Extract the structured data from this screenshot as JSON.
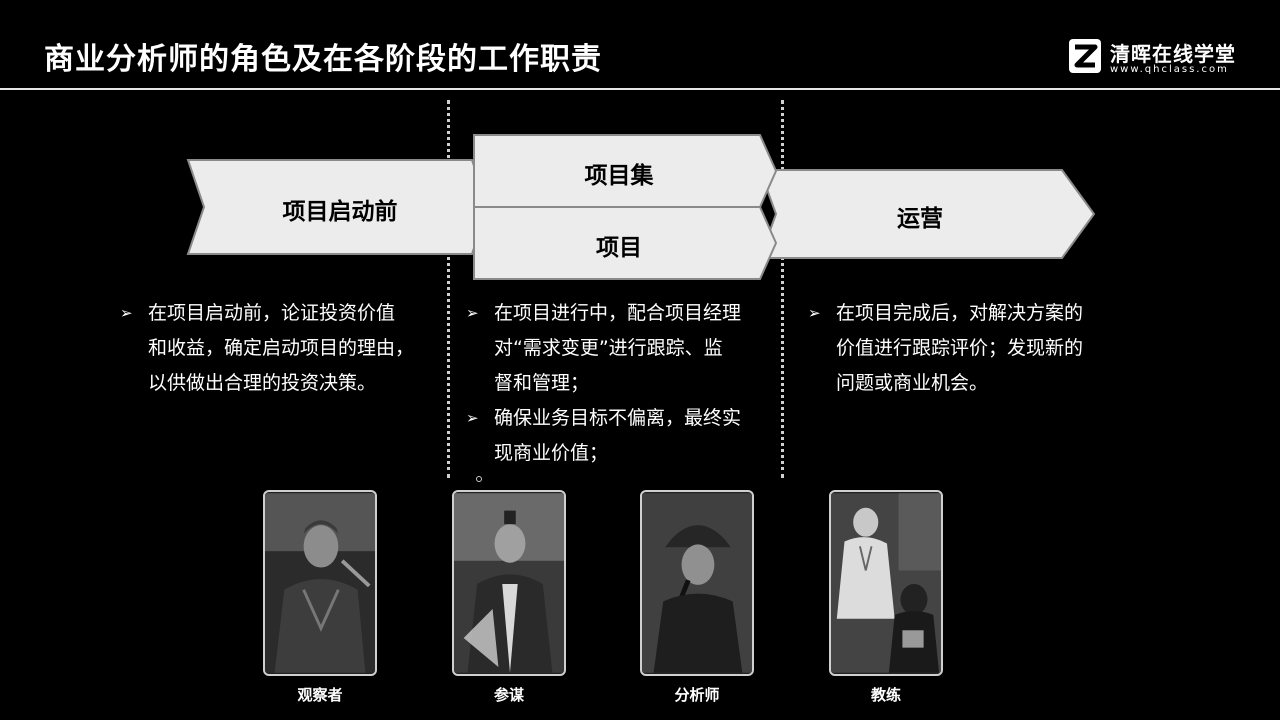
{
  "title": "商业分析师的角色及在各阶段的工作职责",
  "logo": {
    "name": "清晖在线学堂",
    "url": "www.qhclass.com"
  },
  "phases": {
    "pre_project": "项目启动前",
    "program": "项目集",
    "project": "项目",
    "operations": "运营"
  },
  "col1": {
    "bullets": [
      {
        "lines": [
          "在项目启动前，论证投资价值",
          "和收益，确定启动项目的理由，",
          "以供做出合理的投资决策。"
        ]
      }
    ]
  },
  "col2": {
    "bullets": [
      {
        "lines": [
          "在项目进行中，配合项目经理",
          "对“需求变更”进行跟踪、监",
          "督和管理；"
        ]
      },
      {
        "lines": [
          "确保业务目标不偏离，最终实",
          "现商业价值；"
        ]
      }
    ]
  },
  "col3": {
    "bullets": [
      {
        "lines": [
          "在项目完成后，对解决方案的",
          "价值进行跟踪评价；发现新的",
          "问题或商业机会。"
        ]
      }
    ]
  },
  "roles": [
    "观察者",
    "参谋",
    "分析师",
    "教练"
  ],
  "colors": {
    "background": "#000000",
    "arrow_fill": "#ececec",
    "arrow_stroke": "#8a8a8a",
    "text": "#ffffff"
  }
}
